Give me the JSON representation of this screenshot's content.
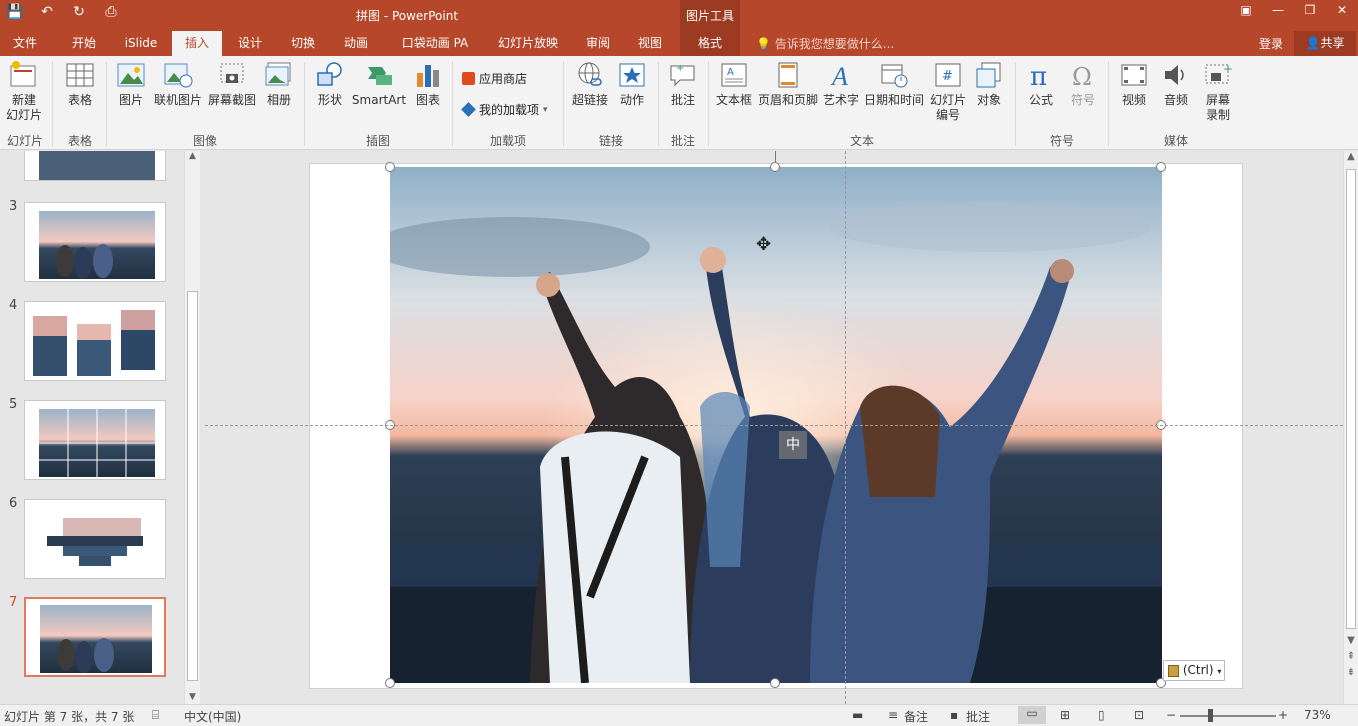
{
  "app": {
    "title": "拼图 - PowerPoint",
    "context_group": "图片工具"
  },
  "qat": [
    "save-icon",
    "undo-icon",
    "redo-icon",
    "present-icon"
  ],
  "window_controls": [
    "ribbon-display-icon",
    "minimize-icon",
    "restore-icon",
    "close-icon"
  ],
  "tabs": [
    {
      "label": "文件"
    },
    {
      "label": "开始"
    },
    {
      "label": "iSlide"
    },
    {
      "label": "插入"
    },
    {
      "label": "设计"
    },
    {
      "label": "切换"
    },
    {
      "label": "动画"
    },
    {
      "label": "口袋动画 PA"
    },
    {
      "label": "幻灯片放映"
    },
    {
      "label": "审阅"
    },
    {
      "label": "视图"
    },
    {
      "label": "格式"
    }
  ],
  "tell_me": "告诉我您想要做什么...",
  "login": "登录",
  "share": "共享",
  "ribbon": {
    "buttons": [
      {
        "label": "新建\n幻灯片",
        "icon": "new-slide-icon"
      },
      {
        "label": "表格",
        "icon": "table-icon"
      },
      {
        "label": "图片",
        "icon": "picture-icon"
      },
      {
        "label": "联机图片",
        "icon": "online-picture-icon"
      },
      {
        "label": "屏幕截图",
        "icon": "screenshot-icon"
      },
      {
        "label": "相册",
        "icon": "album-icon"
      },
      {
        "label": "形状",
        "icon": "shapes-icon"
      },
      {
        "label": "SmartArt",
        "icon": "smartart-icon"
      },
      {
        "label": "图表",
        "icon": "chart-icon"
      },
      {
        "label": "超链接",
        "icon": "hyperlink-icon"
      },
      {
        "label": "动作",
        "icon": "action-icon"
      },
      {
        "label": "批注",
        "icon": "comment-icon"
      },
      {
        "label": "文本框",
        "icon": "textbox-icon"
      },
      {
        "label": "页眉和页脚",
        "icon": "header-footer-icon"
      },
      {
        "label": "艺术字",
        "icon": "wordart-icon"
      },
      {
        "label": "日期和时间",
        "icon": "datetime-icon"
      },
      {
        "label": "幻灯片\n编号",
        "icon": "slide-number-icon"
      },
      {
        "label": "对象",
        "icon": "object-icon"
      },
      {
        "label": "公式",
        "icon": "equation-icon"
      },
      {
        "label": "符号",
        "icon": "symbol-icon"
      },
      {
        "label": "视频",
        "icon": "video-icon"
      },
      {
        "label": "音频",
        "icon": "audio-icon"
      },
      {
        "label": "屏幕\n录制",
        "icon": "screen-record-icon"
      }
    ],
    "addins": {
      "store": "应用商店",
      "my_addins": "我的加载项"
    },
    "groups": [
      "幻灯片",
      "表格",
      "图像",
      "插图",
      "加载项",
      "链接",
      "批注",
      "文本",
      "符号",
      "媒体"
    ]
  },
  "slides": {
    "numbers": [
      "3",
      "4",
      "5",
      "6",
      "7"
    ],
    "active": "7"
  },
  "canvas": {
    "center_mark": "中",
    "paste_options": "(Ctrl)"
  },
  "status": {
    "slide_info": "幻灯片 第 7 张，共 7 张",
    "language": "中文(中国)",
    "notes": "备注",
    "comments": "批注",
    "zoom": "73%"
  },
  "colors": {
    "accent": "#b7472a",
    "context_tab": "#9c3a22"
  }
}
